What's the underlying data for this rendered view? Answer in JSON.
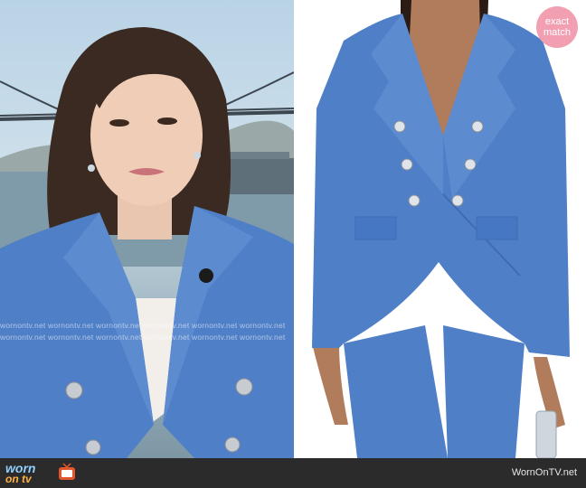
{
  "left_photo": {
    "subject": "news-anchor-in-blue-blazer",
    "watermark_text": "wornontv.net wornontv.net wornontv.net wornontv.net wornontv.net wornontv.net"
  },
  "right_photo": {
    "subject": "product-shot-blue-double-breasted-blazer",
    "badge": {
      "line1": "exact",
      "line2": "match"
    }
  },
  "footer": {
    "logo_line1": "worn",
    "logo_line2": "on tv",
    "site_name": "WornOnTV.net"
  },
  "colors": {
    "blazer": "#4f7fc7",
    "badge": "#f2a0b1",
    "footer": "#2b2b2b"
  }
}
